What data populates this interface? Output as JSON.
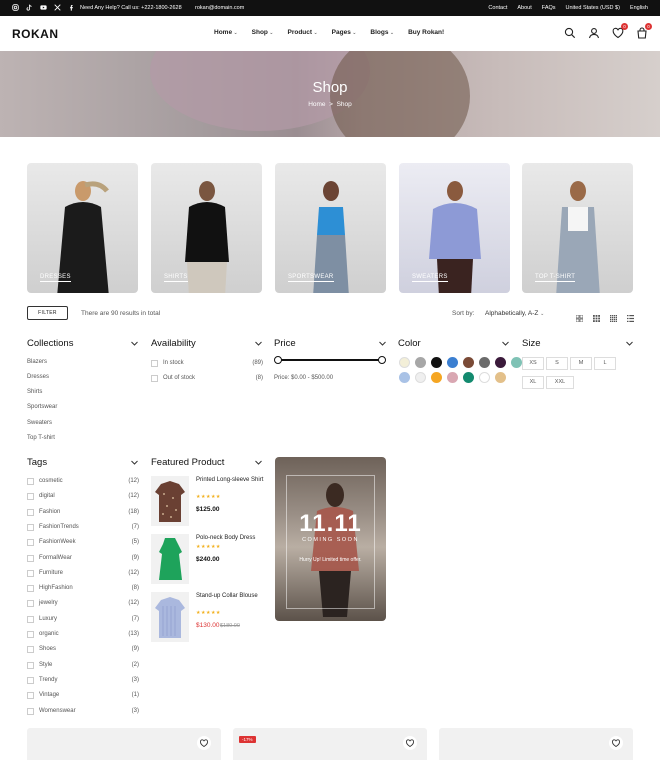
{
  "topbar": {
    "help": "Need Any Help? Call us: +222-1800-2628",
    "email": "rokan@domain.com",
    "links": [
      "Contact",
      "About",
      "FAQs",
      "United States (USD $)",
      "English"
    ]
  },
  "header": {
    "logo": "ROKAN",
    "nav": [
      "Home",
      "Shop",
      "Product",
      "Pages",
      "Blogs",
      "Buy Rokan!"
    ],
    "wishlist_count": "0",
    "cart_count": "0"
  },
  "hero": {
    "title": "Shop",
    "crumb_home": "Home",
    "crumb_current": "Shop"
  },
  "categories": [
    "DRESSES",
    "SHIRTS",
    "SPORTSWEAR",
    "SWEATERS",
    "TOP T-SHIRT"
  ],
  "toolbar": {
    "filter": "FILTER",
    "results": "There are 90 results in total",
    "sort_label": "Sort by:",
    "sort_value": "Alphabetically, A-Z"
  },
  "filters": {
    "collections": {
      "title": "Collections",
      "items": [
        "Blazers",
        "Dresses",
        "Shirts",
        "Sportswear",
        "Sweaters",
        "Top T-shirt"
      ]
    },
    "availability": {
      "title": "Availability",
      "items": [
        {
          "label": "In stock",
          "count": "(89)"
        },
        {
          "label": "Out of stock",
          "count": "(8)"
        }
      ]
    },
    "price": {
      "title": "Price",
      "text": "Price: $0.00 - $500.00"
    },
    "color": {
      "title": "Color",
      "swatches": [
        "#f3efd8",
        "#a7a7a7",
        "#111111",
        "#3b7fd1",
        "#7a4a36",
        "#6b6b6b",
        "#3b1a3b",
        "#7fc2b5",
        "#a9c2e6",
        "#efefef",
        "#f5a623",
        "#d9a7b2",
        "#138a6f",
        "#ffffff",
        "#e3c08a"
      ]
    },
    "size": {
      "title": "Size",
      "items": [
        "XS",
        "S",
        "M",
        "L",
        "XL",
        "XXL"
      ]
    },
    "tags": {
      "title": "Tags",
      "items": [
        {
          "label": "cosmetic",
          "count": "(12)"
        },
        {
          "label": "digital",
          "count": "(12)"
        },
        {
          "label": "Fashion",
          "count": "(18)"
        },
        {
          "label": "FashionTrends",
          "count": "(7)"
        },
        {
          "label": "FashionWeek",
          "count": "(5)"
        },
        {
          "label": "FormalWear",
          "count": "(9)"
        },
        {
          "label": "Furniture",
          "count": "(12)"
        },
        {
          "label": "HighFashion",
          "count": "(8)"
        },
        {
          "label": "jewelry",
          "count": "(12)"
        },
        {
          "label": "Luxury",
          "count": "(7)"
        },
        {
          "label": "organic",
          "count": "(13)"
        },
        {
          "label": "Shoes",
          "count": "(9)"
        },
        {
          "label": "Style",
          "count": "(2)"
        },
        {
          "label": "Trendy",
          "count": "(3)"
        },
        {
          "label": "Vintage",
          "count": "(1)"
        },
        {
          "label": "Womenswear",
          "count": "(3)"
        }
      ]
    }
  },
  "featured": {
    "title": "Featured Product",
    "items": [
      {
        "name": "Printed Long-sleeve Shirt",
        "stars": "★★★★★",
        "price": "$125.00",
        "old": ""
      },
      {
        "name": "Polo-neck Body Dress",
        "stars": "★★★★★",
        "price": "$240.00",
        "old": ""
      },
      {
        "name": "Stand-up Collar Blouse",
        "stars": "★★★★★",
        "price": "$130.00",
        "old": "$180.00"
      }
    ]
  },
  "promo": {
    "big": "11.11",
    "soon": "COMING SOON",
    "sub": "Hurry Up! Limited time offer."
  },
  "cards": {
    "badge": "-17%"
  }
}
